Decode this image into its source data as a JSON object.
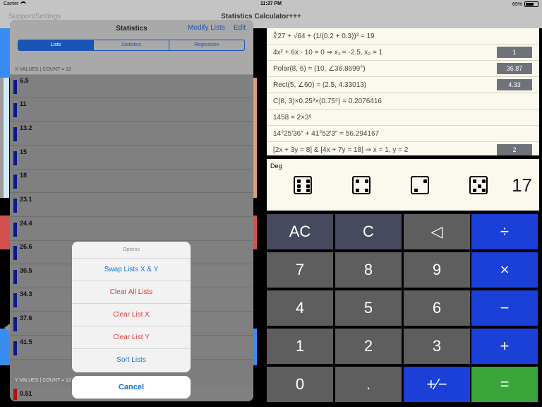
{
  "status": {
    "carrier": "Carrier",
    "time": "11:37 PM",
    "battery": "69%",
    "battery_level": 0.69
  },
  "nav": {
    "back": "Support/Settings",
    "title": "Statistics Calculator+++"
  },
  "history": [
    {
      "expr": "∜27 + √64 + (1/(0.2 + 0.3))³ = 19",
      "btn": ""
    },
    {
      "expr": "4x² + 6x - 10 = 0     ⇒     x₁ = -2.5, x₂ = 1",
      "btn": "1"
    },
    {
      "expr": "Polar(8, 6) = (10, ∠36.8699°)",
      "btn": "36.87"
    },
    {
      "expr": "Rect(5, ∠60) = (2.5, 4.33013)",
      "btn": "4.33"
    },
    {
      "expr": "C(8, 3)×0.25³×(0.75⁵) = 0.2076416",
      "btn": ""
    },
    {
      "expr": "1458 = 2×3⁶",
      "btn": ""
    },
    {
      "expr": "14°25′36″ + 41°52′3″ = 56.294167",
      "btn": ""
    },
    {
      "expr": "[2x + 3y = 8]  &  [4x + 7y = 18] ⇒ x = 1, y = 2",
      "btn": "2"
    }
  ],
  "dice": {
    "mode": "Deg",
    "faces": [
      6,
      4,
      2,
      5
    ],
    "total": "17"
  },
  "keypad": {
    "ac": "AC",
    "c": "C",
    "back": "◁",
    "div": "÷",
    "k7": "7",
    "k8": "8",
    "k9": "9",
    "mul": "×",
    "k4": "4",
    "k5": "5",
    "k6": "6",
    "sub": "−",
    "k1": "1",
    "k2": "2",
    "k3": "3",
    "add": "+",
    "k0": "0",
    "dot": ".",
    "sign": "+∕−",
    "eq": "="
  },
  "stats": {
    "title": "Statistics",
    "modify": "Modify Lists",
    "edit": "Edit",
    "tabs": [
      "Lists",
      "Statistics",
      "Regression"
    ],
    "x_header": "X VALUES | COUNT = 12",
    "x_values": [
      "6.5",
      "11",
      "13.2",
      "15",
      "18",
      "23.1",
      "24.4",
      "26.6",
      "30.5",
      "34.3",
      "37.6",
      "41.5"
    ],
    "y_header": "Y VALUES | COUNT = 12",
    "y_first": "0.51"
  },
  "sheet": {
    "title": "Options",
    "items": [
      {
        "label": "Swap Lists X & Y",
        "tone": "blue"
      },
      {
        "label": "Clear All Lists",
        "tone": "red"
      },
      {
        "label": "Clear List X",
        "tone": "red"
      },
      {
        "label": "Clear List Y",
        "tone": "red"
      },
      {
        "label": "Sort Lists",
        "tone": "blue"
      }
    ],
    "cancel": "Cancel"
  }
}
